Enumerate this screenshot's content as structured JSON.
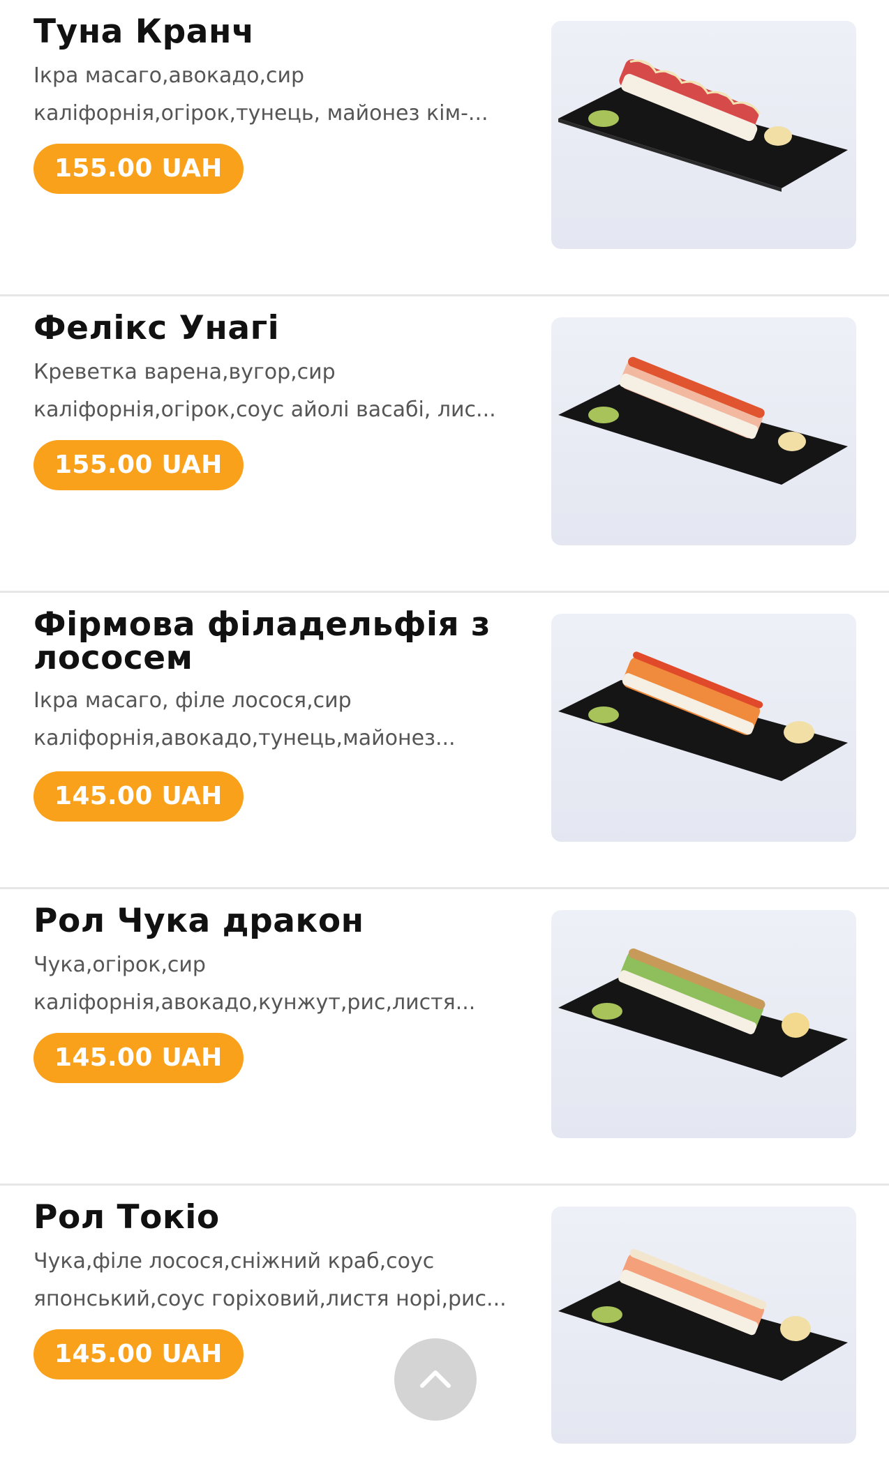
{
  "currency": "UAH",
  "accent_color": "#f9a11b",
  "items": [
    {
      "title": "Туна Кранч",
      "desc_line1": "Ікра масаго,авокадо,сир",
      "desc_line2": "каліфорнія,огірок,тунець, майонез кім-...",
      "price": "155.00 UAH",
      "image": "sushi-roll-tuna-crunch"
    },
    {
      "title": "Фелікс Унагі",
      "desc_line1": "Креветка варена,вугор,сир",
      "desc_line2": "каліфорнія,огірок,соус айолі васабі, лис...",
      "price": "155.00 UAH",
      "image": "sushi-roll-felix-unagi"
    },
    {
      "title_line1": "Фірмова філадельфія з",
      "title_line2": "лососем",
      "desc_line1": "Ікра масаго, філе лосося,сир",
      "desc_line2": "каліфорнія,авокадо,тунець,майонез...",
      "price": "145.00 UAH",
      "image": "sushi-roll-philadelphia-salmon"
    },
    {
      "title": "Рол Чука дракон",
      "desc_line1": "Чука,огірок,сир",
      "desc_line2": "каліфорнія,авокадо,кунжут,рис,листя...",
      "price": "145.00 UAH",
      "image": "sushi-roll-chuka-dragon"
    },
    {
      "title": "Рол Токіо",
      "desc_line1": "Чука,філе лосося,сніжний краб,соус",
      "desc_line2": "японський,соус горіховий,листя норі,рис...",
      "price": "145.00 UAH",
      "image": "sushi-roll-tokyo"
    }
  ],
  "scroll_top_icon": "chevron-up-icon"
}
